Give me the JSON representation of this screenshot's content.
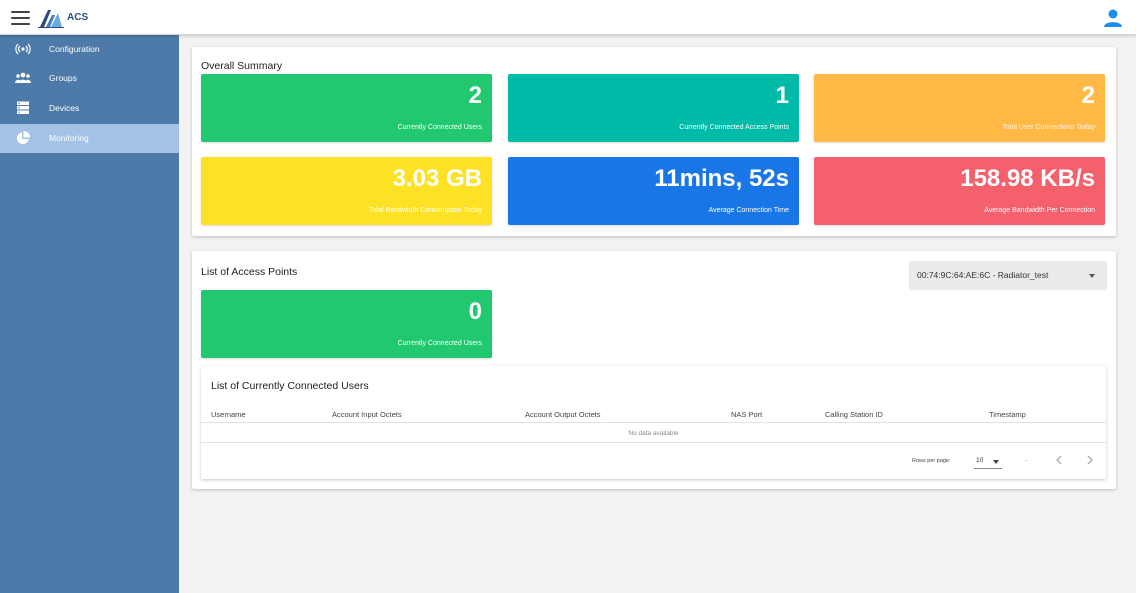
{
  "header": {
    "brand": "ACS",
    "menu_icon": "hamburger-menu-icon",
    "user_icon": "account-icon",
    "accent_color": "#1f8ee8"
  },
  "sidebar": {
    "items": [
      {
        "label": "Configuration",
        "icon": "broadcast-icon",
        "active": false
      },
      {
        "label": "Groups",
        "icon": "groups-icon",
        "active": false
      },
      {
        "label": "Devices",
        "icon": "server-icon",
        "active": false
      },
      {
        "label": "Monitoring",
        "icon": "pie-chart-icon",
        "active": true
      }
    ]
  },
  "summary": {
    "title": "Overall Summary",
    "tiles": [
      {
        "value": "2",
        "label": "Currently Connected Users",
        "color": "#21c870"
      },
      {
        "value": "1",
        "label": "Currently Connected Access Points",
        "color": "#00bba7"
      },
      {
        "value": "2",
        "label": "Total User Connections Today",
        "color": "#ffb944"
      },
      {
        "value": "3.03 GB",
        "label": "Total Bandwidth Consumption Today",
        "color": "#fde125"
      },
      {
        "value": "11mins, 52s",
        "label": "Average Connection Time",
        "color": "#1876e6"
      },
      {
        "value": "158.98 KB/s",
        "label": "Average Bandwidth Per Connection",
        "color": "#f5606d"
      }
    ]
  },
  "access_points": {
    "title": "List of Access Points",
    "selected": "00:74:9C:64:AE:6C - Radiator_test",
    "tile": {
      "value": "0",
      "label": "Currently Connected Users",
      "color": "#21c870"
    }
  },
  "users_table": {
    "title": "List of Currently Connected Users",
    "columns": [
      "Username",
      "Account Input Octets",
      "Account Output Octets",
      "NAS Port",
      "Calling Station ID",
      "Timestamp"
    ],
    "empty_text": "No data available",
    "rows_per_page_label": "Rows per page:",
    "rows_per_page": "10",
    "range": "-"
  }
}
